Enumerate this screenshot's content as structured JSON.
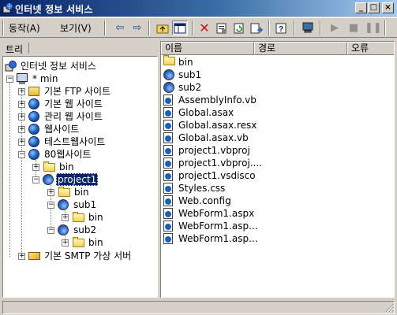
{
  "window": {
    "title": "인터넷 정보 서비스"
  },
  "menu": {
    "action": "동작(A)",
    "view": "보기(V)"
  },
  "toolbar": {
    "buttons": [
      "back-icon",
      "forward-icon",
      "up-folder-icon",
      "show-hide-tree-icon",
      "delete-icon",
      "properties-icon",
      "refresh-icon",
      "export-list-icon",
      "help-icon",
      "computer-icon",
      "play-icon",
      "stop-icon",
      "pause-icon"
    ]
  },
  "tree": {
    "tab_label": "트리",
    "nodes": [
      {
        "label": "인터넷 정보 서비스",
        "icon": "iis-icon"
      },
      {
        "label": "* min",
        "icon": "computer-icon"
      },
      {
        "label": "기본 FTP 사이트",
        "icon": "ftp-site-icon"
      },
      {
        "label": "기본 웹 사이트",
        "icon": "web-site-icon"
      },
      {
        "label": "관리 웹 사이트",
        "icon": "web-site-icon"
      },
      {
        "label": "웹사이트",
        "icon": "web-site-icon"
      },
      {
        "label": "테스트웹사이트",
        "icon": "web-site-icon"
      },
      {
        "label": "80웹사이트",
        "icon": "web-site-icon"
      },
      {
        "label": "bin",
        "icon": "folder-icon"
      },
      {
        "label": "project1",
        "icon": "web-app-icon",
        "selected": true
      },
      {
        "label": "bin",
        "icon": "folder-icon"
      },
      {
        "label": "sub1",
        "icon": "web-app-icon"
      },
      {
        "label": "bin",
        "icon": "folder-icon"
      },
      {
        "label": "sub2",
        "icon": "web-app-icon"
      },
      {
        "label": "bin",
        "icon": "folder-icon"
      },
      {
        "label": "기본 SMTP 가상 서버",
        "icon": "smtp-icon"
      }
    ]
  },
  "list": {
    "columns": [
      "이름",
      "경로",
      "오류"
    ],
    "items": [
      {
        "name": "bin",
        "icon": "folder-icon"
      },
      {
        "name": "sub1",
        "icon": "web-app-icon"
      },
      {
        "name": "sub2",
        "icon": "web-app-icon"
      },
      {
        "name": "AssemblyInfo.vb",
        "icon": "file-icon"
      },
      {
        "name": "Global.asax",
        "icon": "file-icon"
      },
      {
        "name": "Global.asax.resx",
        "icon": "file-icon"
      },
      {
        "name": "Global.asax.vb",
        "icon": "file-icon"
      },
      {
        "name": "project1.vbproj",
        "icon": "file-icon"
      },
      {
        "name": "project1.vbproj....",
        "icon": "file-icon"
      },
      {
        "name": "project1.vsdisco",
        "icon": "file-icon"
      },
      {
        "name": "Styles.css",
        "icon": "file-icon"
      },
      {
        "name": "Web.config",
        "icon": "file-icon"
      },
      {
        "name": "WebForm1.aspx",
        "icon": "file-icon"
      },
      {
        "name": "WebForm1.asp...",
        "icon": "file-icon"
      },
      {
        "name": "WebForm1.asp...",
        "icon": "file-icon"
      }
    ]
  },
  "colors": {
    "title_active": "#0a246a",
    "selection": "#0a246a",
    "face": "#d4d0c8"
  }
}
